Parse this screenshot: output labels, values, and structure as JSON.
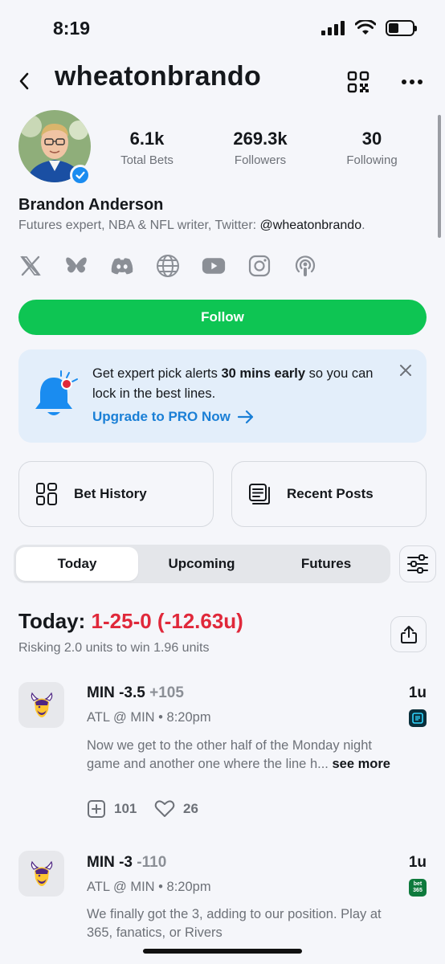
{
  "status": {
    "time": "8:19"
  },
  "header": {
    "username": "wheatonbrando"
  },
  "profile": {
    "name": "Brandon Anderson",
    "bio_prefix": "Futures expert, NBA & NFL writer, Twitter: ",
    "bio_handle": "@wheatonbrando",
    "bio_suffix": ".",
    "stats": [
      {
        "value": "6.1k",
        "label": "Total Bets"
      },
      {
        "value": "269.3k",
        "label": "Followers"
      },
      {
        "value": "30",
        "label": "Following"
      }
    ],
    "socials": [
      "x-icon",
      "bluesky-icon",
      "discord-icon",
      "globe-icon",
      "youtube-icon",
      "instagram-icon",
      "podcast-icon"
    ]
  },
  "follow_label": "Follow",
  "promo": {
    "text_1": "Get expert pick alerts ",
    "text_bold": "30 mins early",
    "text_2": " so you can lock in the best lines.",
    "cta": "Upgrade to PRO Now"
  },
  "cards": {
    "bet_history": "Bet History",
    "recent_posts": "Recent Posts"
  },
  "tabs": [
    {
      "label": "Today",
      "active": true
    },
    {
      "label": "Upcoming",
      "active": false
    },
    {
      "label": "Futures",
      "active": false
    }
  ],
  "today": {
    "label": "Today:",
    "record": "1-25-0 (-12.63u)",
    "risk": "Risking 2.0 units to win 1.96 units"
  },
  "picks": [
    {
      "title": "MIN -3.5",
      "odds": "+105",
      "units": "1u",
      "meta": "ATL @ MIN • 8:20pm",
      "text_1": "Now we get to the other half of the Monday night",
      "text_2": "game and another one where the line h...",
      "see_more": "see more",
      "adds": "101",
      "likes": "26"
    },
    {
      "title": "MIN -3",
      "odds": "-110",
      "units": "1u",
      "meta": "ATL @ MIN • 8:20pm",
      "text_1": "We finally got the 3, adding to our position. Play at",
      "text_2": "365, fanatics, or Rivers"
    }
  ],
  "colors": {
    "accent_green": "#0ec553",
    "record_red": "#e0283a",
    "link_blue": "#1a7fd6",
    "verified_blue": "#1a8cf0"
  }
}
